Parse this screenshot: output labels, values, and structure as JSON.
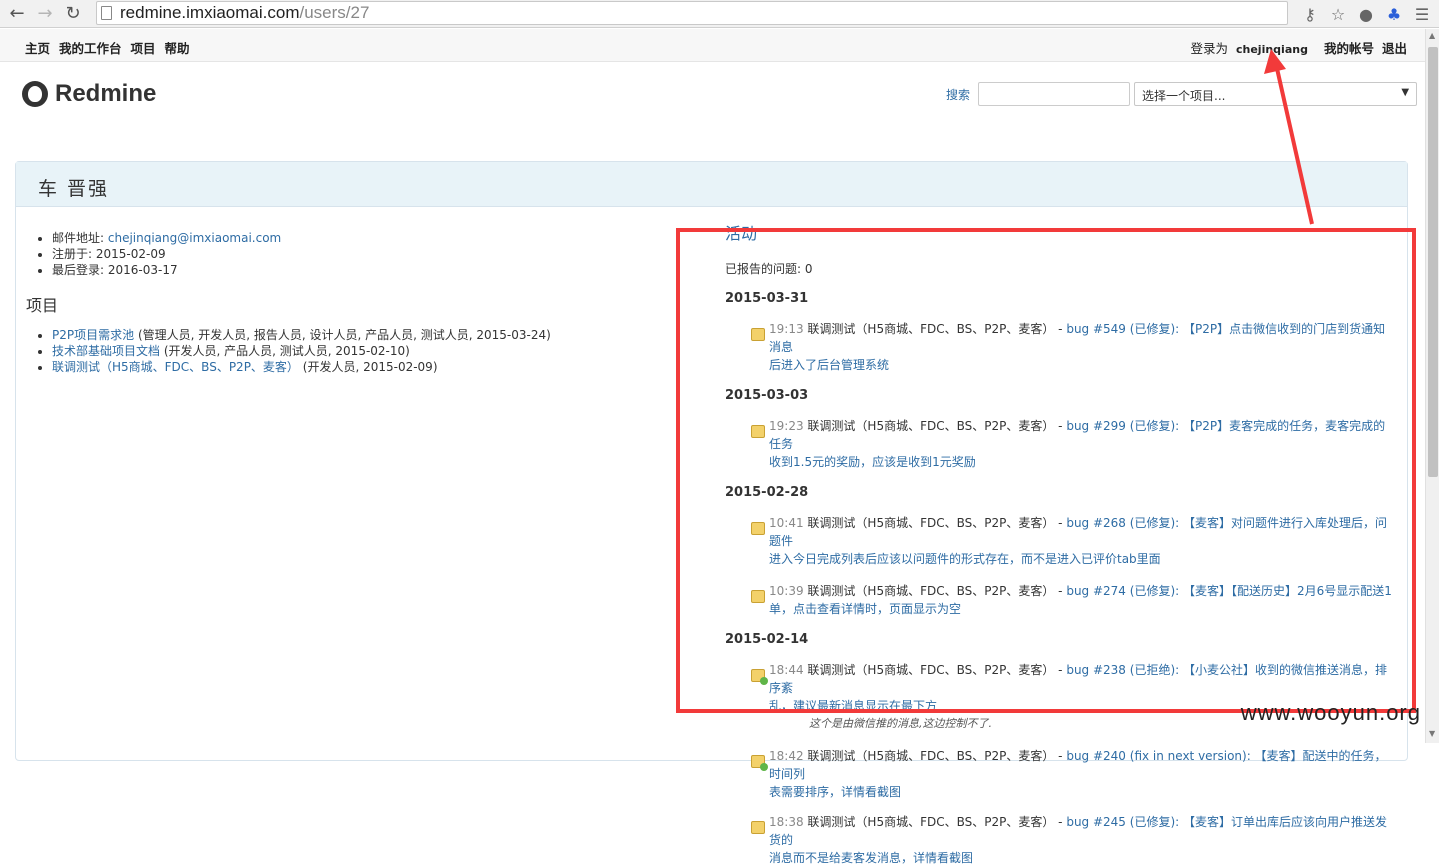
{
  "browser": {
    "url_host": "redmine.imxiaomai.com",
    "url_path": "/users/27"
  },
  "top_menu": {
    "items": [
      "主页",
      "我的工作台",
      "项目",
      "帮助"
    ],
    "logged_as_label": "登录为",
    "user": "chejinqiang",
    "my_account": "我的帐号",
    "logout": "退出"
  },
  "header": {
    "logo_text": "Redmine",
    "search_label": "搜索",
    "search_value": "",
    "project_select": "选择一个项目..."
  },
  "user": {
    "name": "车 晋强",
    "email_label": "邮件地址:",
    "email": "chejinqiang@imxiaomai.com",
    "registered_label": "注册于:",
    "registered": "2015-02-09",
    "last_login_label": "最后登录:",
    "last_login": "2016-03-17"
  },
  "projects": {
    "heading": "项目",
    "items": [
      {
        "name": "P2P项目需求池",
        "roles": "(管理人员, 开发人员, 报告人员, 设计人员, 产品人员, 测试人员, 2015-03-24)"
      },
      {
        "name": "技术部基础项目文档",
        "roles": "(开发人员, 产品人员, 测试人员, 2015-02-10)"
      },
      {
        "name": "联调测试（H5商城、FDC、BS、P2P、麦客）",
        "roles": "(开发人员, 2015-02-09)"
      }
    ]
  },
  "activity": {
    "heading": "活动",
    "reported": "已报告的问题: 0",
    "days": [
      {
        "date": "2015-03-31",
        "events": [
          {
            "time": "19:13",
            "project": "联调测试（H5商城、FDC、BS、P2P、麦客）",
            "sep": " - ",
            "line1": "bug #549 (已修复): 【P2P】点击微信收到的门店到货通知消息",
            "line2": "后进入了后台管理系统",
            "closed": false
          }
        ]
      },
      {
        "date": "2015-03-03",
        "events": [
          {
            "time": "19:23",
            "project": "联调测试（H5商城、FDC、BS、P2P、麦客）",
            "sep": " - ",
            "line1": "bug #299 (已修复): 【P2P】麦客完成的任务，麦客完成的任务",
            "line2": "收到1.5元的奖励，应该是收到1元奖励",
            "closed": false
          }
        ]
      },
      {
        "date": "2015-02-28",
        "events": [
          {
            "time": "10:41",
            "project": "联调测试（H5商城、FDC、BS、P2P、麦客）",
            "sep": " - ",
            "line1": "bug #268 (已修复): 【麦客】对问题件进行入库处理后，问题件",
            "line2": "进入今日完成列表后应该以问题件的形式存在，而不是进入已评价tab里面",
            "closed": false
          },
          {
            "time": "10:39",
            "project": "联调测试（H5商城、FDC、BS、P2P、麦客）",
            "sep": " - ",
            "line1": "bug #274 (已修复): 【麦客】【配送历史】2月6号显示配送1",
            "line2": "单，点击查看详情时，页面显示为空",
            "closed": false
          }
        ]
      },
      {
        "date": "2015-02-14",
        "events": [
          {
            "time": "18:44",
            "project": "联调测试（H5商城、FDC、BS、P2P、麦客）",
            "sep": " - ",
            "line1": "bug #238 (已拒绝): 【小麦公社】收到的微信推送消息，排序紊",
            "line2": "乱，建议最新消息显示在最下方",
            "desc": "这个是由微信推的消息,这边控制不了.",
            "closed": true
          },
          {
            "time": "18:42",
            "project": "联调测试（H5商城、FDC、BS、P2P、麦客）",
            "sep": " - ",
            "line1": "bug #240 (fix in next version): 【麦客】配送中的任务，时间列",
            "line2": "表需要排序，详情看截图",
            "closed": true
          },
          {
            "time": "18:38",
            "project": "联调测试（H5商城、FDC、BS、P2P、麦客）",
            "sep": " - ",
            "line1": "bug #245 (已修复): 【麦客】订单出库后应该向用户推送发货的",
            "line2": "消息而不是给麦客发消息，详情看截图",
            "closed": false
          }
        ]
      }
    ]
  },
  "watermark": "www.wooyun.org",
  "colors": {
    "link": "#2e6ca4",
    "annotation": "#f23a3a",
    "title_bar": "#e8f3f8"
  }
}
